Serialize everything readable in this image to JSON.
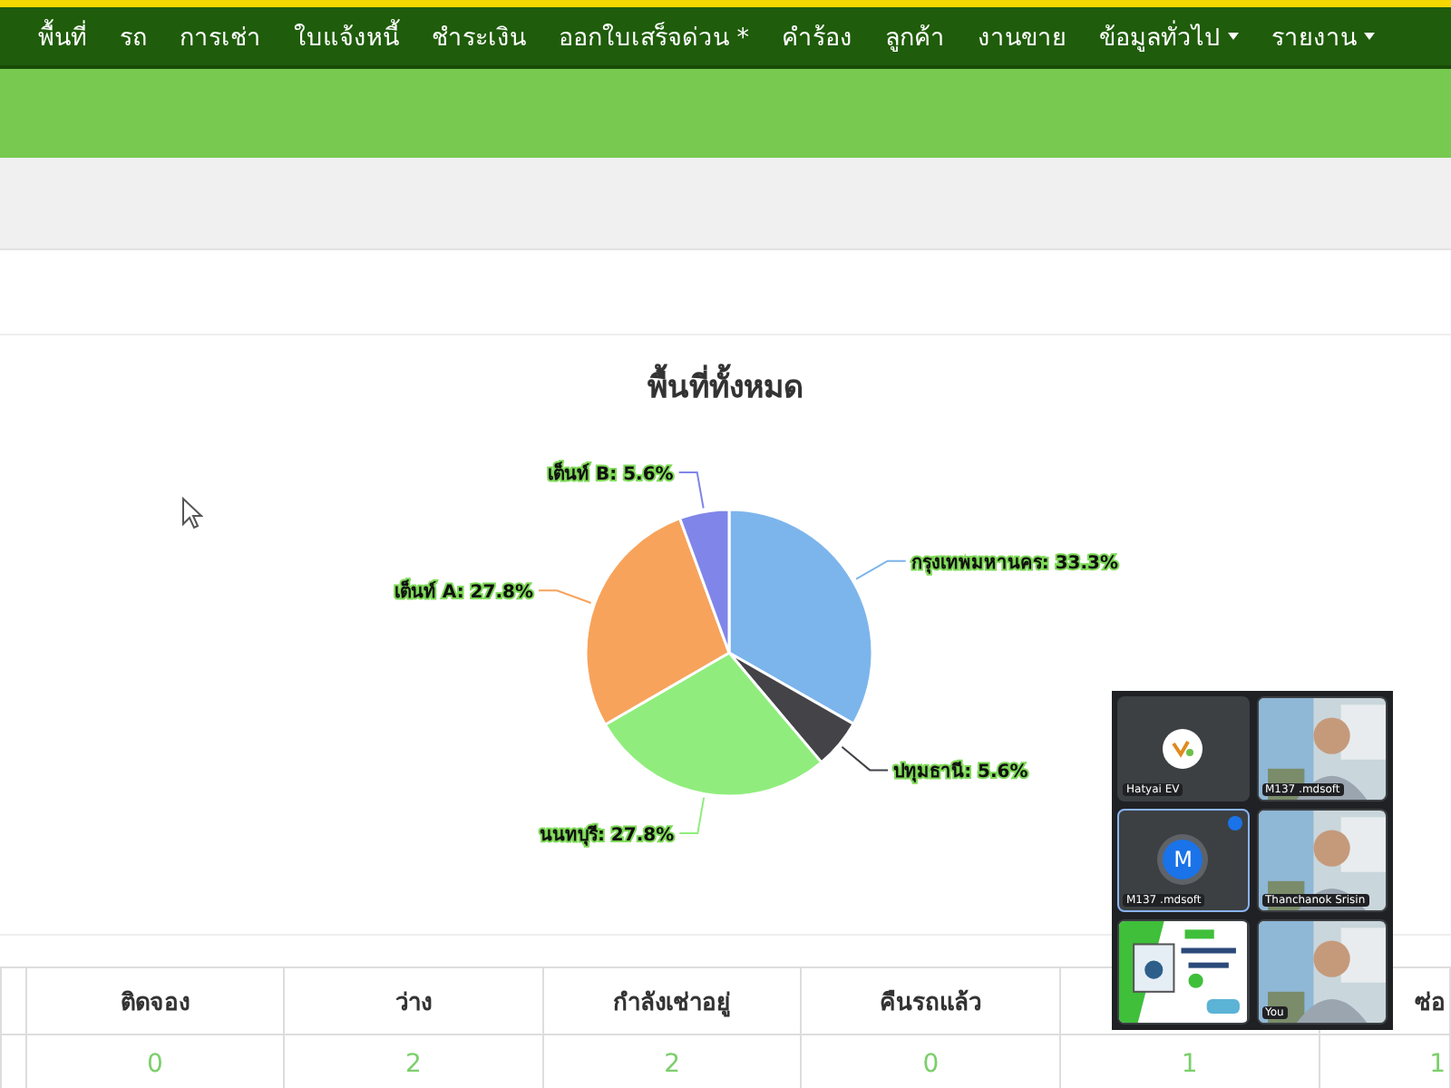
{
  "navbar": {
    "items": [
      {
        "label": "พื้นที่",
        "dropdown": false
      },
      {
        "label": "รถ",
        "dropdown": false
      },
      {
        "label": "การเช่า",
        "dropdown": false
      },
      {
        "label": "ใบแจ้งหนี้",
        "dropdown": false
      },
      {
        "label": "ชำระเงิน",
        "dropdown": false
      },
      {
        "label": "ออกใบเสร็จด่วน *",
        "dropdown": false
      },
      {
        "label": "คำร้อง",
        "dropdown": false
      },
      {
        "label": "ลูกค้า",
        "dropdown": false
      },
      {
        "label": "งานขาย",
        "dropdown": false
      },
      {
        "label": "ข้อมูลทั่วไป",
        "dropdown": true
      },
      {
        "label": "รายงาน",
        "dropdown": true
      }
    ]
  },
  "chart": {
    "chart_data": {
      "type": "pie",
      "title": "พื้นที่ทั้งหมด",
      "categories": [
        "กรุงเทพมหานคร",
        "ปทุมธานี",
        "นนทบุรี",
        "เต็นท์ A",
        "เต็นท์ B"
      ],
      "values": [
        33.3,
        5.6,
        27.8,
        27.8,
        5.6
      ],
      "colors": [
        "#7cb5ec",
        "#434348",
        "#90ed7d",
        "#f7a35c",
        "#8085e9"
      ],
      "value_labels": [
        ": 33.3%",
        ": 5.6%",
        ": 27.8%",
        ": 27.8%",
        ": 5.6%"
      ]
    }
  },
  "table": {
    "columns": [
      "ติดจอง",
      "ว่าง",
      "กำลังเช่าอยู่",
      "คืนรถแล้ว",
      "",
      "ซ่อ"
    ],
    "rows": [
      [
        "0",
        "2",
        "2",
        "0",
        "1",
        "1"
      ]
    ]
  },
  "meeting": {
    "tiles": [
      {
        "name": "Hatyai EV",
        "kind": "logo",
        "active": false
      },
      {
        "name": "M137 .mdsoft",
        "kind": "video",
        "active": false
      },
      {
        "name": "M137 .mdsoft",
        "kind": "avatar",
        "initial": "M",
        "active": true
      },
      {
        "name": "Thanchanok Srisin",
        "kind": "video",
        "active": false
      },
      {
        "kind": "screen",
        "active": false
      },
      {
        "name": "You",
        "kind": "video",
        "active": false
      }
    ]
  }
}
